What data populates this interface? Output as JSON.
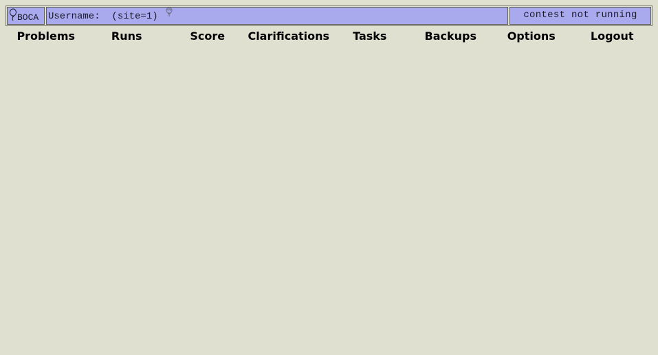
{
  "header": {
    "logo_text": "BOCA",
    "username_label": "Username:  (site=1)",
    "contest_status": "contest not running"
  },
  "menu": {
    "items": [
      {
        "label": "Problems"
      },
      {
        "label": "Runs"
      },
      {
        "label": "Score"
      },
      {
        "label": "Clarifications"
      },
      {
        "label": "Tasks"
      },
      {
        "label": "Backups"
      },
      {
        "label": "Options"
      },
      {
        "label": "Logout"
      }
    ]
  },
  "colors": {
    "background": "#dfe0d0",
    "header_cell": "#a9a9ee"
  }
}
